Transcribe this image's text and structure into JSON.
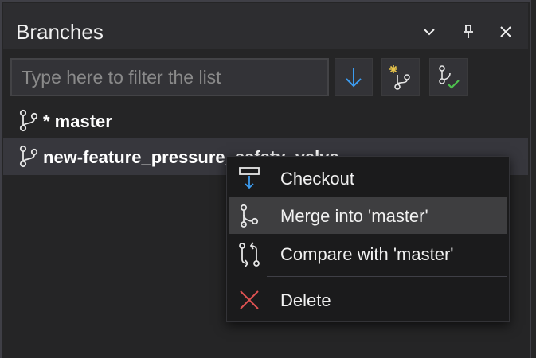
{
  "panel": {
    "title": "Branches",
    "buttons": [
      {
        "icon": "chevron-down-icon"
      },
      {
        "icon": "pin-icon"
      },
      {
        "icon": "close-icon"
      }
    ]
  },
  "filter": {
    "placeholder": "Type here to filter the list",
    "value": ""
  },
  "toolbar": [
    {
      "icon": "arrow-down-icon"
    },
    {
      "icon": "new-branch-icon"
    },
    {
      "icon": "branch-check-icon"
    }
  ],
  "branches": [
    {
      "label": "* master",
      "current": true,
      "icon": "branch-icon"
    },
    {
      "label": "new-feature_pressure_safety_valve",
      "selected": true,
      "icon": "branch-icon"
    }
  ],
  "context_menu": {
    "items": [
      {
        "label": "Checkout",
        "icon": "checkout-icon"
      },
      {
        "label": "Merge into 'master'",
        "icon": "merge-icon",
        "highlighted": true
      },
      {
        "label": "Compare with 'master'",
        "icon": "compare-icon"
      },
      {
        "label": "Delete",
        "icon": "delete-icon",
        "color": "#e05252"
      }
    ]
  },
  "colors": {
    "background": "#252526",
    "accent": "#3c9cf0",
    "sparkle": "#e8c44a",
    "check": "#4ec24e",
    "delete": "#e05252"
  }
}
